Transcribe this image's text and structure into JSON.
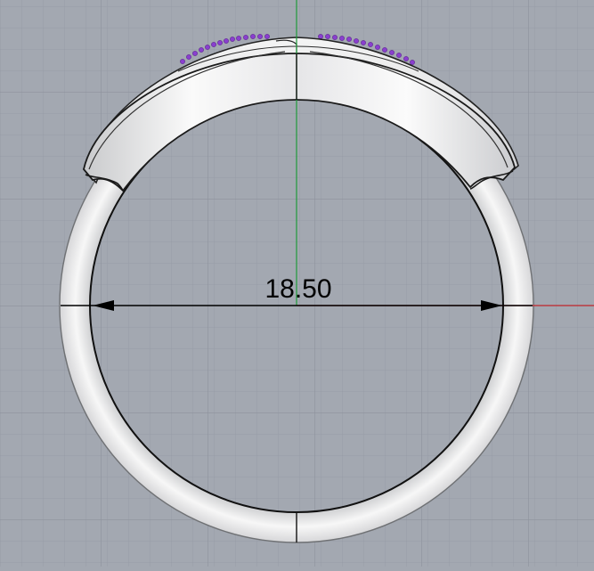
{
  "viewport": {
    "view": "Front",
    "background_color": "#a3a8b1",
    "grid_minor_color": "#979ca6",
    "grid_major_color": "#8c919b",
    "x_axis_color": "#c1272d",
    "y_axis_color": "#1f9a3a"
  },
  "model": {
    "object": "ring",
    "metal_color": "#e4e4e4",
    "gem_color": "#8a3fcf"
  },
  "dimension": {
    "type": "diameter",
    "value_label": "18.50",
    "arrow_color": "#000000"
  }
}
